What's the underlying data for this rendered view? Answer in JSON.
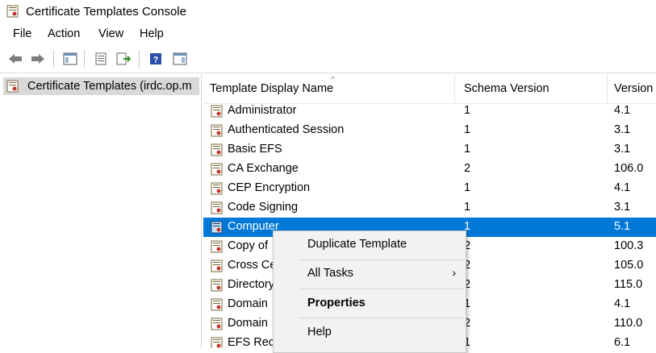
{
  "window": {
    "title": "Certificate Templates Console"
  },
  "menubar": {
    "items": [
      "File",
      "Action",
      "View",
      "Help"
    ]
  },
  "tree": {
    "root_label": "Certificate Templates (irdc.op.m"
  },
  "list": {
    "columns": [
      "Template Display Name",
      "Schema Version",
      "Version"
    ],
    "rows": [
      {
        "name": "Administrator",
        "schema": "1",
        "version": "4.1"
      },
      {
        "name": "Authenticated Session",
        "schema": "1",
        "version": "3.1"
      },
      {
        "name": "Basic EFS",
        "schema": "1",
        "version": "3.1"
      },
      {
        "name": "CA Exchange",
        "schema": "2",
        "version": "106.0"
      },
      {
        "name": "CEP Encryption",
        "schema": "1",
        "version": "4.1"
      },
      {
        "name": "Code Signing",
        "schema": "1",
        "version": "3.1"
      },
      {
        "name": "Computer",
        "schema": "1",
        "version": "5.1",
        "selected": true
      },
      {
        "name": "Copy of",
        "schema": "2",
        "version": "100.3"
      },
      {
        "name": "Cross Ce",
        "schema": "2",
        "version": "105.0"
      },
      {
        "name": "Directory",
        "schema": "2",
        "version": "115.0"
      },
      {
        "name": "Domain",
        "schema": "1",
        "version": "4.1"
      },
      {
        "name": "Domain",
        "schema": "2",
        "version": "110.0"
      },
      {
        "name": "EFS Reco",
        "schema": "1",
        "version": "6.1"
      }
    ]
  },
  "context_menu": {
    "duplicate_template": "Duplicate Template",
    "all_tasks": "All Tasks",
    "properties": "Properties",
    "help": "Help",
    "submenu_glyph": "›"
  },
  "colors": {
    "selection": "#0078d7",
    "menu_bg": "#f2f2f2"
  }
}
